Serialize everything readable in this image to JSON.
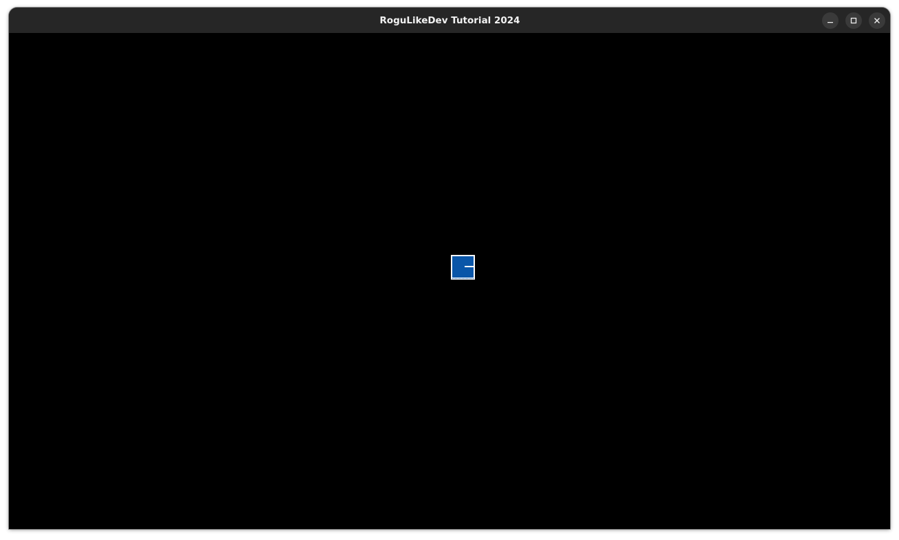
{
  "window": {
    "title": "RoguLikeDev Tutorial 2024",
    "controls": {
      "minimize_icon": "minimize-icon",
      "maximize_icon": "maximize-icon",
      "close_icon": "close-icon"
    }
  },
  "game": {
    "background_color": "#000000",
    "player": {
      "tile_fill": "#0a56a8",
      "tile_border": "#ffffff"
    }
  }
}
